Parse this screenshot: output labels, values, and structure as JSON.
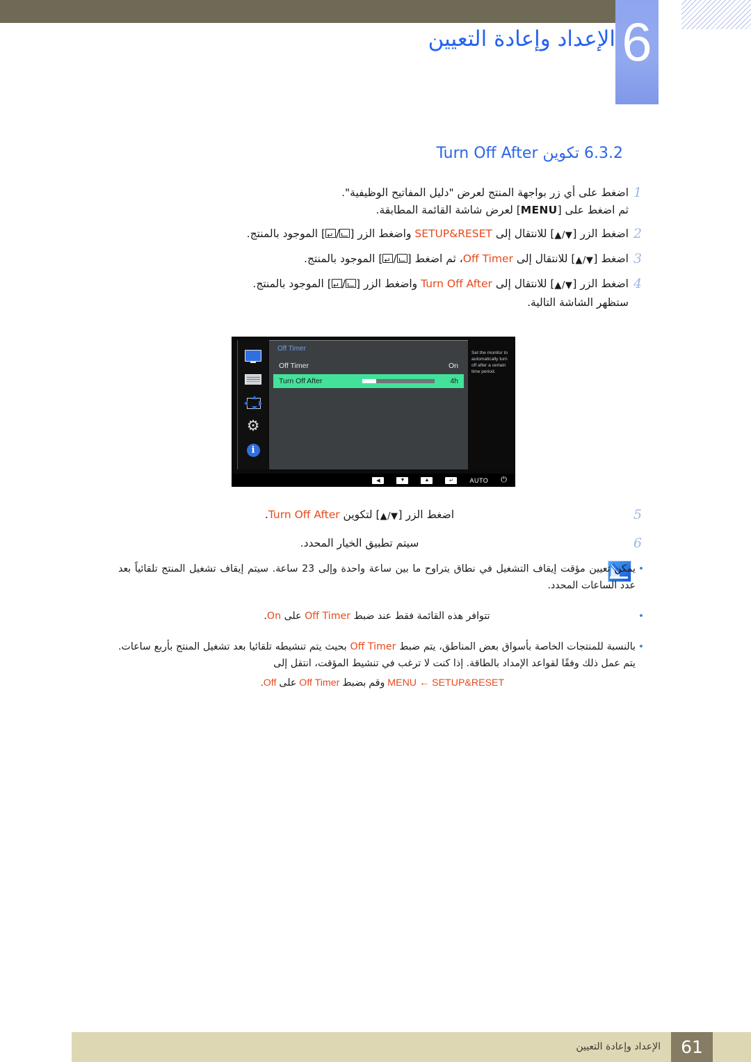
{
  "header": {
    "chapter_number": "6",
    "chapter_title": "الإعداد وإعادة التعيين"
  },
  "section": {
    "number": "6.3.2",
    "title_ar": "تكوين",
    "title_en": "Turn Off After"
  },
  "steps": [
    {
      "num": "1",
      "line1_a": "اضغط على أي زر بواجهة المنتج لعرض \"دليل المفاتيح الوظيفية\".",
      "line2_a": "ثم اضغط على [",
      "line2_key": "MENU",
      "line2_b": "] لعرض شاشة القائمة المطابقة."
    },
    {
      "num": "2",
      "a": "اضغط الزر [",
      "arrows": "▲/▼",
      "b": "] للانتقال إلى ",
      "menu": "SETUP&RESET",
      "c": " واضغط الزر [",
      "d": "] الموجود بالمنتج."
    },
    {
      "num": "3",
      "a": "اضغط [",
      "arrows": "▲/▼",
      "b": "] للانتقال إلى ",
      "menu": "Off Timer",
      "c": "، ثم اضغط [",
      "d": "] الموجود بالمنتج."
    },
    {
      "num": "4",
      "a": "اضغط الزر [",
      "arrows": "▲/▼",
      "b": "] للانتقال إلى ",
      "menu": "Turn Off After",
      "c": " واضغط الزر [",
      "d": "] الموجود بالمنتج.",
      "extra": "ستظهر الشاشة التالية."
    },
    {
      "num": "5",
      "a": "اضغط الزر [",
      "arrows": "▲/▼",
      "b": "] لتكوين ",
      "menu": "Turn Off After",
      "c": "."
    },
    {
      "num": "6",
      "a": "سيتم تطبيق الخيار المحدد."
    }
  ],
  "osd": {
    "menu_title": "Off Timer",
    "rows": [
      {
        "label": "Off Timer",
        "value": "On",
        "selected": false,
        "has_bar": false
      },
      {
        "label": "Turn Off After",
        "value": "4h",
        "selected": true,
        "has_bar": true,
        "bar_percent": 19
      }
    ],
    "help_text": "Set the monitor to automatically turn off after a certain time period.",
    "sidebar_icons": [
      "monitor-icon",
      "picture-list-icon",
      "position-arrows-icon",
      "gear-icon",
      "info-icon"
    ],
    "bottom_keys": [
      {
        "name": "left-arrow-key",
        "glyph": "◀"
      },
      {
        "name": "down-arrow-key",
        "glyph": "▼"
      },
      {
        "name": "up-arrow-key",
        "glyph": "▲"
      },
      {
        "name": "enter-key",
        "glyph": "↵"
      },
      {
        "name": "auto-key",
        "glyph": "AUTO"
      },
      {
        "name": "power-key",
        "glyph": "⏻"
      }
    ]
  },
  "notes": [
    {
      "text": "يمكن تعيين مؤقت إيقاف التشغيل في نطاق يتراوح ما بين ساعة واحدة وإلى 23 ساعة. سيتم إيقاف تشغيل المنتج تلقائياً بعد عدد الساعات المحدد."
    },
    {
      "text_a": "تتوافر هذه القائمة فقط عند ضبط ",
      "menu_a": "Off Timer",
      "text_b": " على ",
      "menu_b": "On",
      "text_c": "."
    },
    {
      "text_a": "بالنسبة للمنتجات الخاصة بأسواق بعض المناطق، يتم ضبط ",
      "menu_a": "Off Timer",
      "text_b": " بحيث يتم تنشيطه تلقائيا بعد تشغيل المنتج بأربع ساعات. يتم عمل ذلك وفقًا لقواعد الإمداد بالطاقة. إذا كنت لا ترغب في تنشيط المؤقت، انتقل إلى"
    }
  ],
  "note_last_line": {
    "menu_path": "MENU ← SETUP&RESET",
    "mid": " وقم بضبط ",
    "menu_a": "Off Timer",
    "text_b": " على ",
    "menu_b": "Off",
    "text_c": "."
  },
  "footer": {
    "page_number": "61",
    "text": "الإعداد وإعادة التعيين"
  },
  "colors": {
    "header_band": "#6e6a55",
    "chapter_block": "#8fa6ef",
    "title_blue": "#2563f0",
    "menu_orange": "#e8491c",
    "osd_highlight": "#42e29a",
    "footer_band": "#ded7b3",
    "page_box": "#857c63"
  }
}
